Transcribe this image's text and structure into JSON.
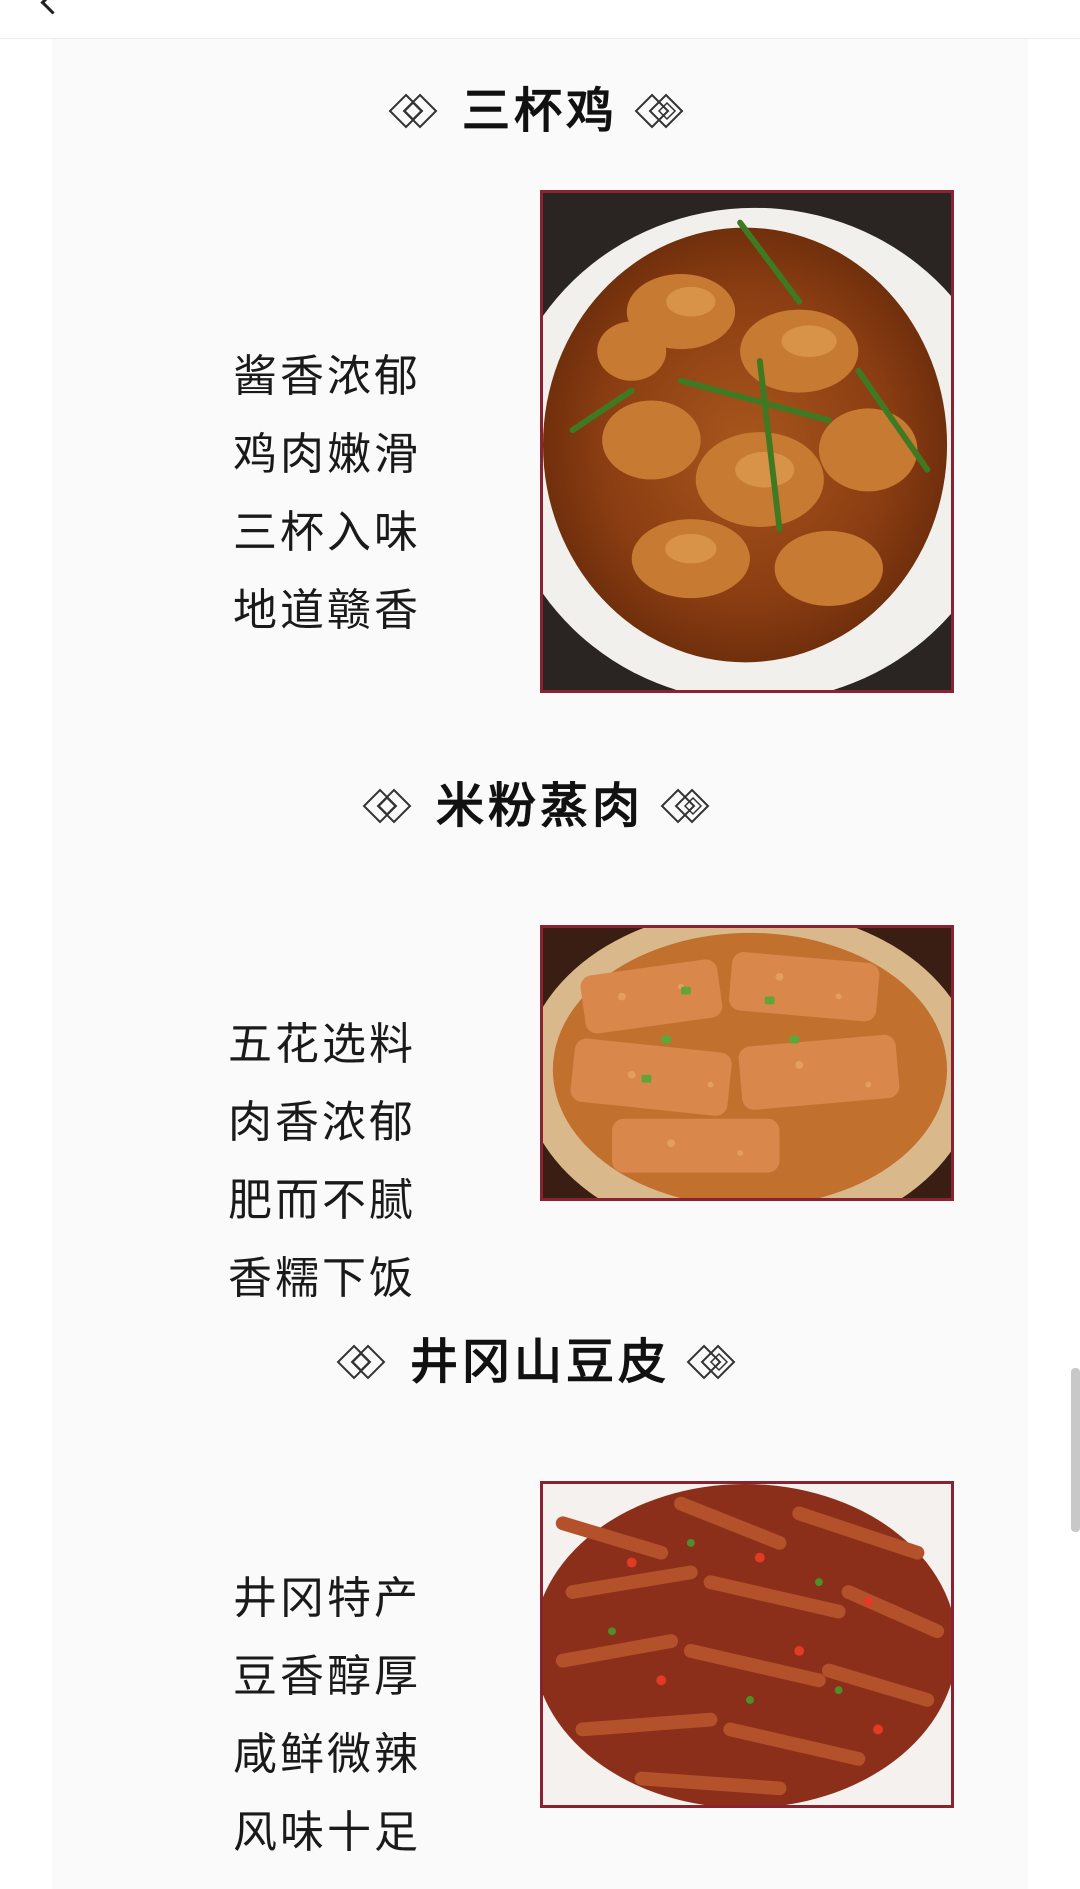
{
  "sections": [
    {
      "title": "三杯鸡",
      "lines": [
        "酱香浓郁",
        "鸡肉嫩滑",
        "三杯入味",
        "地道赣香"
      ],
      "photo_icon": "san-bei-ji-dish-photo"
    },
    {
      "title": "米粉蒸肉",
      "lines": [
        "五花选料",
        "肉香浓郁",
        "肥而不腻",
        "香糯下饭"
      ],
      "photo_icon": "steamed-pork-rice-flour-photo"
    },
    {
      "title": "井冈山豆皮",
      "lines": [
        "井冈特产",
        "豆香醇厚",
        "咸鲜微辣",
        "风味十足"
      ],
      "photo_icon": "jinggangshan-tofu-skin-photo"
    }
  ],
  "colors": {
    "photo_border": "#8a2331",
    "title_text": "#111111",
    "page_background": "#fafafa"
  },
  "icons": {
    "back": "back-chevron-icon",
    "title_ornament": "double-diamond-ornament-icon"
  }
}
